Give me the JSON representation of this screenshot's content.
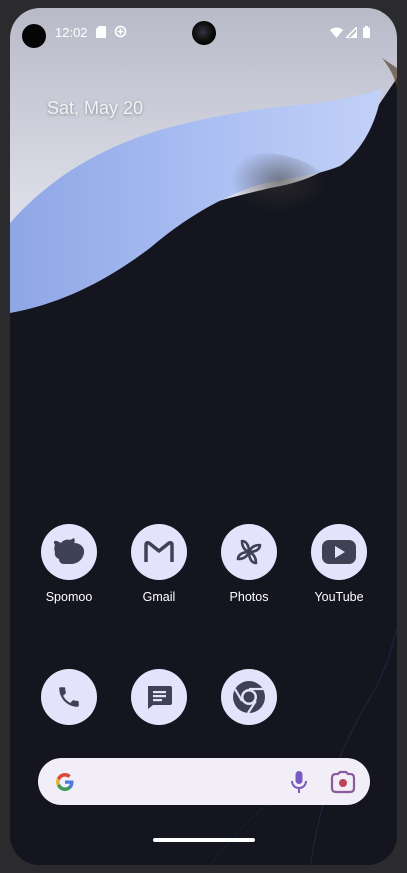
{
  "status_bar": {
    "time": "12:02",
    "left_icons": [
      "sd-card-icon",
      "data-saver-icon"
    ],
    "right_icons": [
      "wifi-icon",
      "cellular-signal-icon",
      "battery-icon"
    ]
  },
  "date_widget": {
    "text": "Sat, May 20"
  },
  "apps_row_1": [
    {
      "label": "Spomoo",
      "icon": "cow-icon"
    },
    {
      "label": "Gmail",
      "icon": "gmail-icon"
    },
    {
      "label": "Photos",
      "icon": "pinwheel-icon"
    },
    {
      "label": "YouTube",
      "icon": "youtube-icon"
    }
  ],
  "dock": [
    {
      "icon": "phone-icon"
    },
    {
      "icon": "messages-icon"
    },
    {
      "icon": "chrome-icon"
    }
  ],
  "search_bar": {
    "left_icon": "google-g-icon",
    "mic_icon": "mic-icon",
    "lens_icon": "lens-camera-icon"
  },
  "colors": {
    "app_icon_bg": "#e3e4fb",
    "app_icon_fg": "#3f4254",
    "search_bg": "#f1eef8",
    "wallpaper_dark": "#14151f",
    "wallpaper_blue": "#9fb5ee"
  }
}
